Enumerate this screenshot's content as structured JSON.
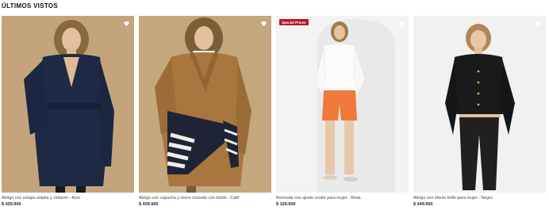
{
  "section": {
    "title": "ÚLTIMOS VISTOS"
  },
  "products": [
    {
      "name": "Abrigo con solapa amplia y cinturón - Azul",
      "price": "$ 439.900",
      "badge": ""
    },
    {
      "name": "Abrigo con capucha y cierre cruzado con botón - Café",
      "price": "$ 439.900",
      "badge": ""
    },
    {
      "name": "Bermuda con ajuste oculto para mujer - Rosa",
      "price": "$ 159.900",
      "badge": "Special Prices"
    },
    {
      "name": "Abrigo con efecto brillo para mujer - Negro",
      "price": "$ 449.900",
      "badge": ""
    }
  ],
  "icons": {
    "favorite": "heart-outline-icon"
  },
  "colors": {
    "badge": "#b31b2c",
    "price": "#222222"
  }
}
